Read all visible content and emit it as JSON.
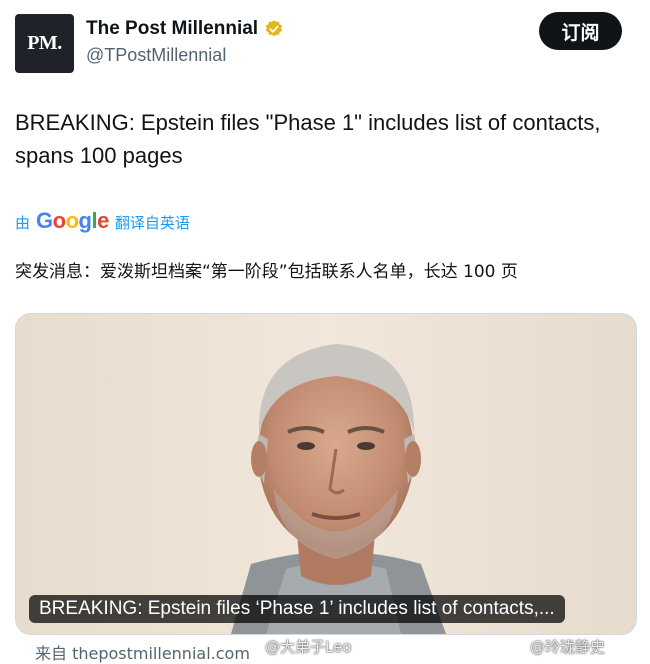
{
  "account": {
    "avatar_text": "PM.",
    "display_name": "The Post Millennial",
    "handle": "@TPostMillennial",
    "verified_color": "#e2b719"
  },
  "subscribe_label": "订阅",
  "tweet": {
    "text": "BREAKING: Epstein files \"Phase 1\" includes list of contacts, spans 100 pages",
    "translate_prefix": "由",
    "translate_brand": "Google",
    "translate_suffix": "翻译自英语",
    "translated_text": "突发消息：爱泼斯坦档案“第一阶段”包括联系人名单，长达 100 页"
  },
  "media": {
    "caption": "BREAKING: Epstein files ‘Phase 1’ includes list of contacts,...",
    "source": "来自 thepostmillennial.com"
  },
  "watermarks": {
    "left": "@大弟子Leo",
    "right": "@玲珑静史"
  }
}
